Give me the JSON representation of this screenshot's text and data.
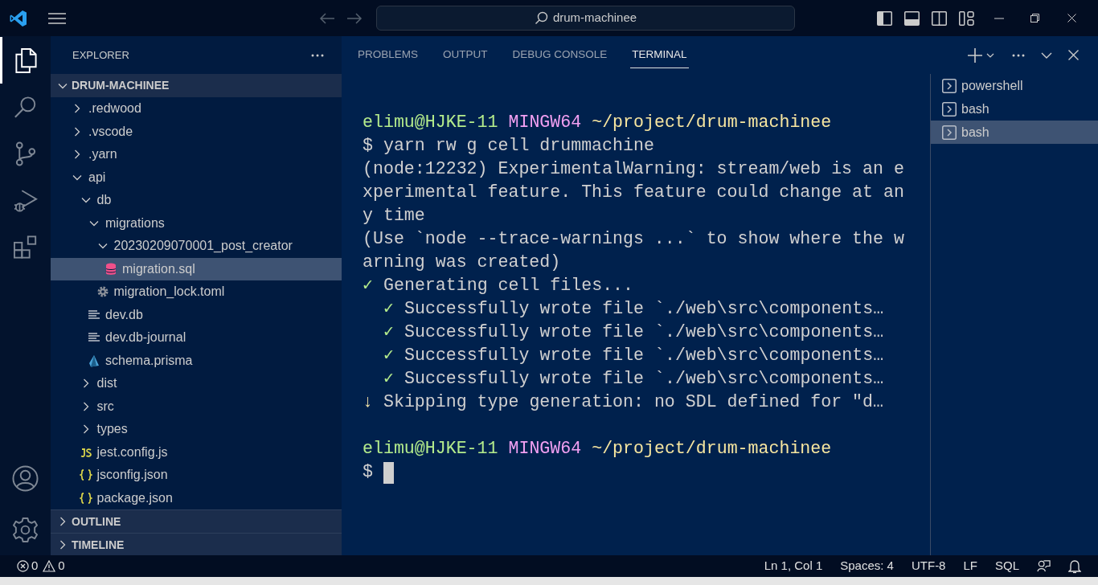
{
  "title_bar": {
    "search": "drum-machinee"
  },
  "activity_bar": [
    {
      "kind": "files",
      "selected": true
    },
    {
      "kind": "search",
      "selected": false
    },
    {
      "kind": "source-control",
      "selected": false
    },
    {
      "kind": "run-debug",
      "selected": false
    },
    {
      "kind": "extensions",
      "selected": false
    }
  ],
  "activity_bar_bottom": [
    {
      "kind": "account"
    },
    {
      "kind": "settings"
    }
  ],
  "explorer": {
    "title": "EXPLORER",
    "root": {
      "label": "DRUM-MACHINEE",
      "expanded": true
    },
    "tree": [
      {
        "kind": "folder",
        "label": ".redwood",
        "expanded": false,
        "selected": false
      },
      {
        "kind": "folder",
        "label": ".vscode",
        "expanded": false,
        "selected": false
      },
      {
        "kind": "folder",
        "label": ".yarn",
        "expanded": false,
        "selected": false
      },
      {
        "kind": "folder",
        "label": "api",
        "expanded": true,
        "selected": false,
        "children": [
          {
            "kind": "folder",
            "label": "db",
            "expanded": true,
            "selected": false,
            "children": [
              {
                "kind": "folder",
                "label": "migrations",
                "expanded": true,
                "selected": false,
                "children": [
                  {
                    "kind": "folder",
                    "label": "20230209070001_post_creator",
                    "expanded": true,
                    "selected": false,
                    "children": [
                      {
                        "kind": "sql",
                        "label": "migration.sql",
                        "selected": true
                      }
                    ]
                  },
                  {
                    "kind": "toml",
                    "label": "migration_lock.toml",
                    "selected": false
                  }
                ]
              },
              {
                "kind": "db",
                "label": "dev.db",
                "selected": false
              },
              {
                "kind": "db",
                "label": "dev.db-journal",
                "selected": false
              },
              {
                "kind": "prisma",
                "label": "schema.prisma",
                "selected": false
              }
            ]
          },
          {
            "kind": "folder",
            "label": "dist",
            "expanded": false,
            "selected": false
          },
          {
            "kind": "folder",
            "label": "src",
            "expanded": false,
            "selected": false
          },
          {
            "kind": "folder",
            "label": "types",
            "expanded": false,
            "selected": false
          },
          {
            "kind": "js",
            "label": "jest.config.js",
            "selected": false
          },
          {
            "kind": "json",
            "label": "jsconfig.json",
            "selected": false
          },
          {
            "kind": "json",
            "label": "package.json",
            "selected": false
          }
        ]
      }
    ],
    "sections": [
      {
        "label": "OUTLINE",
        "expanded": false
      },
      {
        "label": "TIMELINE",
        "expanded": false
      }
    ]
  },
  "panel": {
    "tabs": [
      {
        "label": "PROBLEMS",
        "selected": false
      },
      {
        "label": "OUTPUT",
        "selected": false
      },
      {
        "label": "DEBUG CONSOLE",
        "selected": false
      },
      {
        "label": "TERMINAL",
        "selected": true
      }
    ],
    "terminal": {
      "lines": [
        {
          "kind": "prompt",
          "user": "elimu@HJKE-11",
          "shell": "MINGW64",
          "path": "~/project/drum-machinee"
        },
        {
          "kind": "output",
          "text": "$ yarn rw g cell drummachine"
        },
        {
          "kind": "output",
          "text": "(node:12232) ExperimentalWarning: stream/web is an e"
        },
        {
          "kind": "output",
          "text": "xperimental feature. This feature could change at an"
        },
        {
          "kind": "output",
          "text": "y time"
        },
        {
          "kind": "output",
          "text": "(Use `node --trace-warnings ...` to show where the w"
        },
        {
          "kind": "output",
          "text": "arning was created)"
        },
        {
          "kind": "success",
          "mark": "✓",
          "text": "Generating cell files...",
          "children": [
            {
              "kind": "success",
              "mark": "✓",
              "text": "Successfully wrote file `./web\\src\\components…"
            },
            {
              "kind": "success",
              "mark": "✓",
              "text": "Successfully wrote file `./web\\src\\components…"
            },
            {
              "kind": "success",
              "mark": "✓",
              "text": "Successfully wrote file `./web\\src\\components…"
            },
            {
              "kind": "success",
              "mark": "✓",
              "text": "Successfully wrote file `./web\\src\\components…"
            }
          ]
        },
        {
          "kind": "skipped",
          "mark": "↓",
          "text": "Skipping type generation: no SDL defined for \"d…"
        },
        {
          "kind": "blank"
        },
        {
          "kind": "prompt",
          "user": "elimu@HJKE-11",
          "shell": "MINGW64",
          "path": "~/project/drum-machinee"
        },
        {
          "kind": "input",
          "text": "$"
        }
      ]
    },
    "sessions": [
      {
        "label": "powershell",
        "selected": false
      },
      {
        "label": "bash",
        "selected": false
      },
      {
        "label": "bash",
        "selected": true
      }
    ]
  },
  "status_bar": {
    "errors": "0",
    "warnings": "0",
    "items": [
      "Ln 1, Col 1",
      "Spaces: 4",
      "UTF-8",
      "LF",
      "SQL"
    ]
  }
}
